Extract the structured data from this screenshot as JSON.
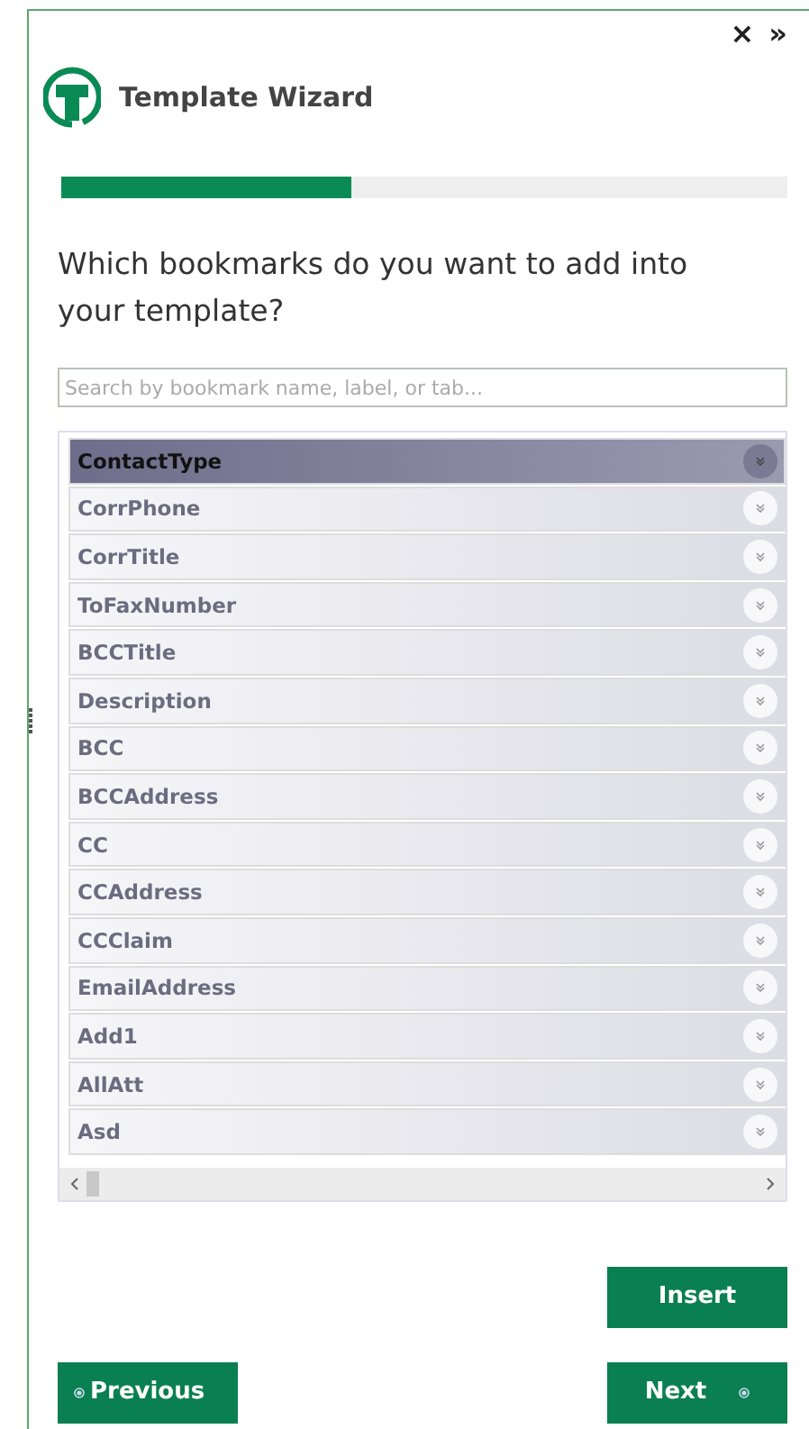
{
  "header": {
    "close": "×",
    "collapse": "»",
    "title": "Template Wizard"
  },
  "progress": {
    "level": 0.4
  },
  "question": "Which bookmarks do you want to add into your template?",
  "search": {
    "placeholder": "Search by bookmark name, label, or tab..."
  },
  "bookmarks": [
    {
      "name": "ContactType",
      "selected": true
    },
    {
      "name": "CorrPhone",
      "selected": false
    },
    {
      "name": "CorrTitle",
      "selected": false
    },
    {
      "name": "ToFaxNumber",
      "selected": false
    },
    {
      "name": "BCCTitle",
      "selected": false
    },
    {
      "name": "Description",
      "selected": false
    },
    {
      "name": "BCC",
      "selected": false
    },
    {
      "name": "BCCAddress",
      "selected": false
    },
    {
      "name": "CC",
      "selected": false
    },
    {
      "name": "CCAddress",
      "selected": false
    },
    {
      "name": "CCClaim",
      "selected": false
    },
    {
      "name": "EmailAddress",
      "selected": false
    },
    {
      "name": "Add1",
      "selected": false
    },
    {
      "name": "AllAtt",
      "selected": false
    },
    {
      "name": "Asd",
      "selected": false
    }
  ],
  "buttons": {
    "insert": "Insert",
    "previous": "Previous",
    "next": "Next"
  }
}
